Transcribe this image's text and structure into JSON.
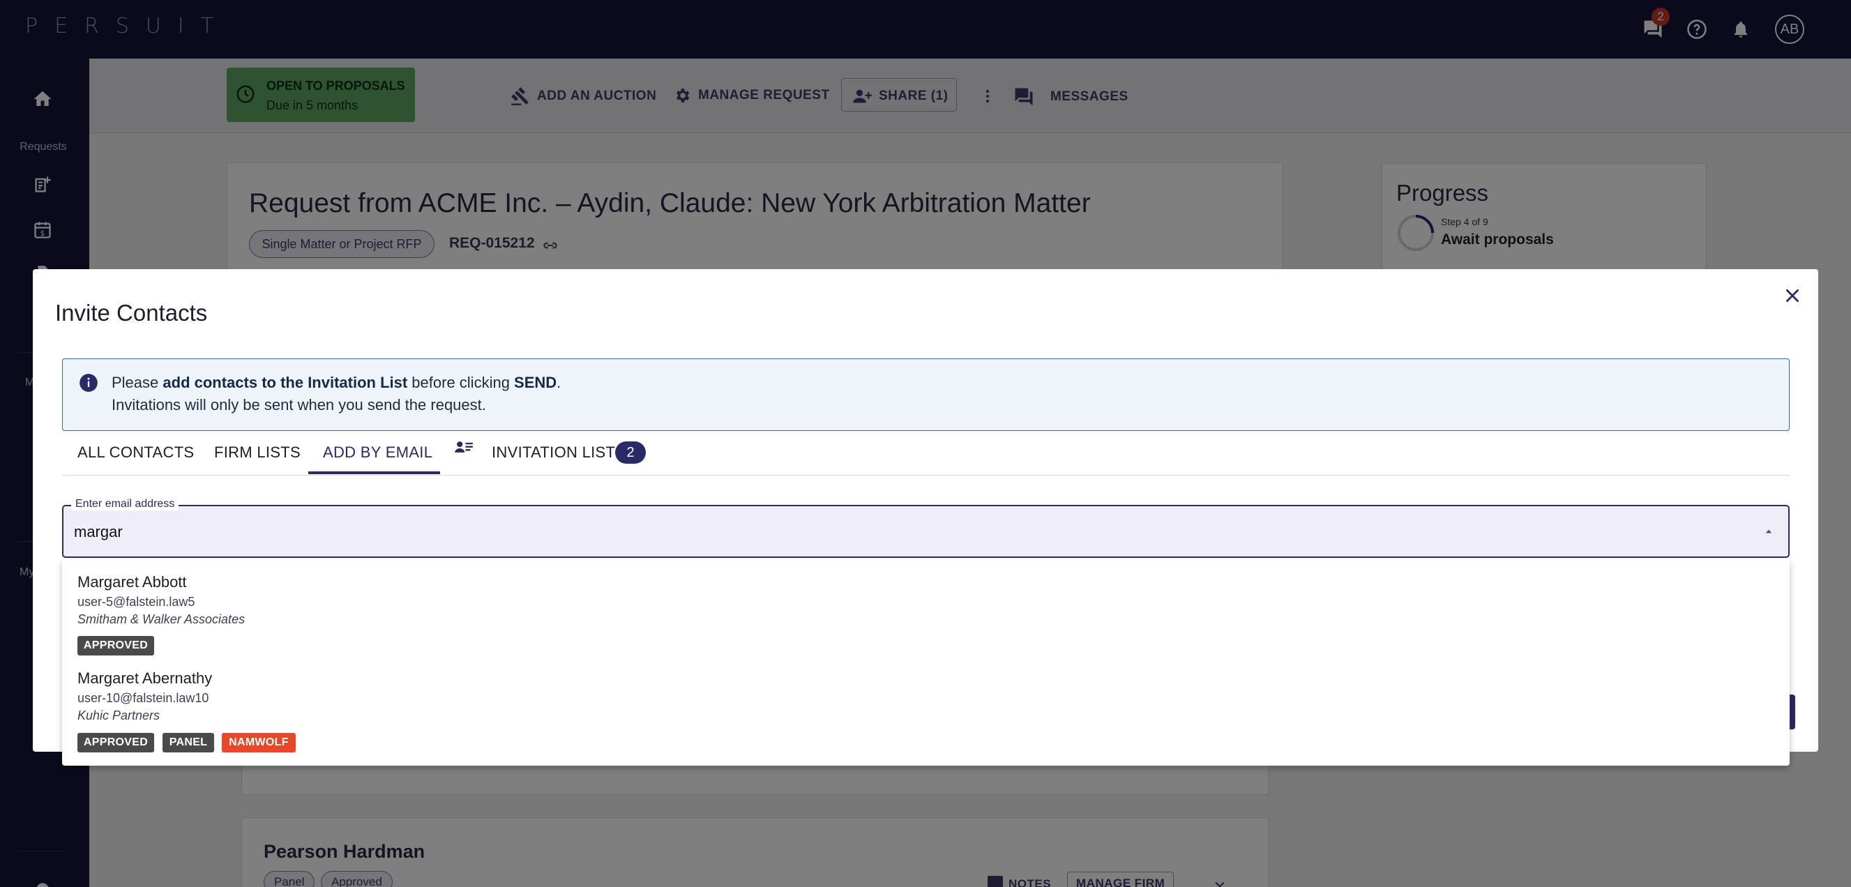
{
  "app": {
    "logo_text": "PERSUIT",
    "notification_badge": "2",
    "avatar_initials": "AB"
  },
  "leftnav": {
    "requests_label": "Requests",
    "partial_label_1": "M",
    "partial_label_2": "My"
  },
  "actionbar": {
    "status_title": "OPEN TO PROPOSALS",
    "status_sub": "Due in 5 months",
    "add_auction": "ADD AN AUCTION",
    "manage_request": "MANAGE REQUEST",
    "share": "SHARE (1)",
    "messages": "MESSAGES"
  },
  "request": {
    "title": "Request from ACME Inc. – Aydin, Claude: New York Arbitration Matter",
    "type_chip": "Single Matter or Project RFP",
    "id": "REQ-015212"
  },
  "progress": {
    "title": "Progress",
    "step": "Step 4 of 9",
    "step_name": "Await proposals"
  },
  "firm_card": {
    "name": "Pearson Hardman",
    "chips": [
      "Panel",
      "Approved"
    ],
    "notes": "NOTES",
    "manage_firm": "MANAGE FIRM"
  },
  "dialog": {
    "title": "Invite Contacts",
    "info_please": "Please ",
    "info_bold1": "add contacts to the Invitation List",
    "info_mid": " before clicking ",
    "info_bold2": "SEND",
    "info_end": ".",
    "info_line2": "Invitations will only be sent when you send the request.",
    "tabs": {
      "all_contacts": "ALL CONTACTS",
      "firm_lists": "FIRM LISTS",
      "add_by_email": "ADD BY EMAIL",
      "invitation_list": "INVITATION LIST",
      "invitation_count": "2"
    },
    "email_field": {
      "label": "Enter email address",
      "value": "margar"
    },
    "options": [
      {
        "name": "Margaret Abbott",
        "email": "user-5@falstein.law5",
        "firm": "Smitham & Walker Associates",
        "tags": [
          "APPROVED"
        ]
      },
      {
        "name": "Margaret Abernathy",
        "email": "user-10@falstein.law10",
        "firm": "Kuhic Partners",
        "tags": [
          "APPROVED",
          "PANEL",
          "NAMWOLF"
        ]
      }
    ]
  },
  "colors": {
    "nav_bg": "#16143a",
    "primary": "#2b2966",
    "status_green": "#5fa560",
    "tag_gray": "#4a4a4a",
    "tag_red": "#e8472a"
  }
}
